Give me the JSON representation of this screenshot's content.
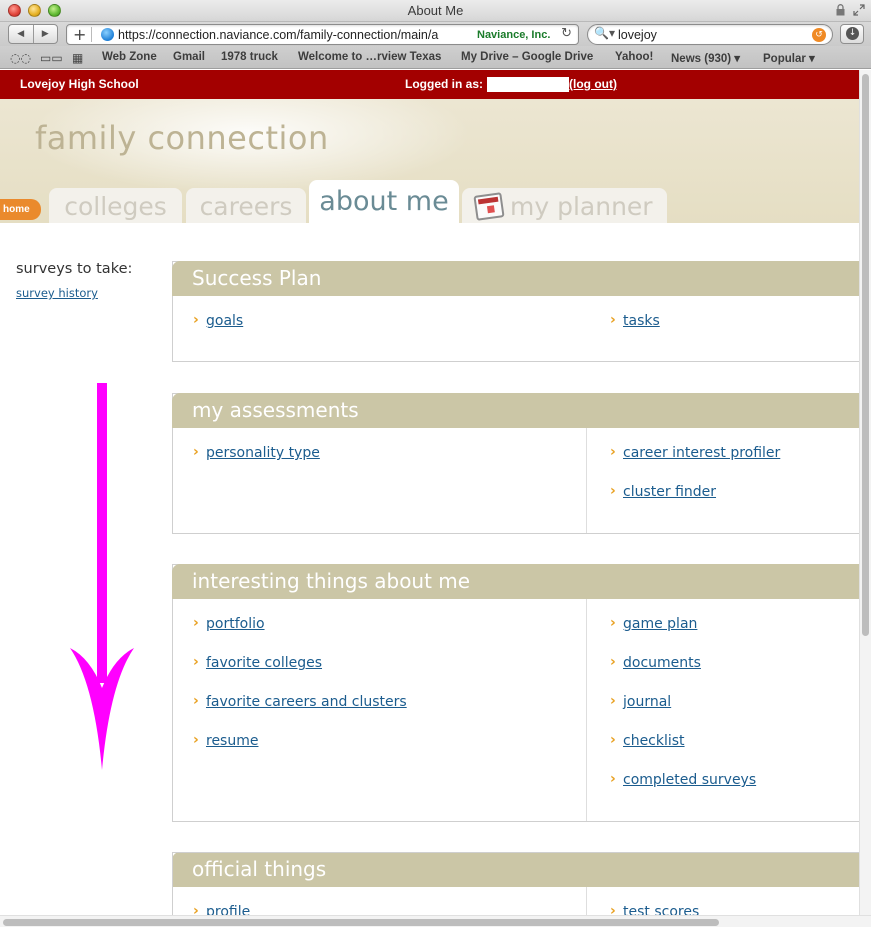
{
  "browser": {
    "window_title": "About Me",
    "url": "https://connection.naviance.com/family-connection/main/a",
    "site_identity": "Naviance, Inc.",
    "search_query": "lovejoy",
    "bookmarks": [
      "Web Zone",
      "Gmail",
      "1978 truck",
      "Welcome to …rview Texas",
      "My Drive – Google Drive",
      "Yahoo!",
      "News (930) ▾",
      "Popular ▾"
    ]
  },
  "header": {
    "school": "Lovejoy High School",
    "logged_in_label": "Logged in as:",
    "logout": "(log out)"
  },
  "brand": "family connection",
  "tabs": {
    "home": "home",
    "colleges": "colleges",
    "careers": "careers",
    "about_me": "about me",
    "my_planner": "my planner"
  },
  "sidebar": {
    "title": "surveys to take:",
    "link": "survey history"
  },
  "panels": [
    {
      "title": "Success Plan",
      "left": [
        "goals"
      ],
      "right": [
        "tasks"
      ]
    },
    {
      "title": "my assessments",
      "left": [
        "personality type"
      ],
      "right": [
        "career interest profiler",
        "cluster finder"
      ]
    },
    {
      "title": "interesting things about me",
      "left": [
        "portfolio",
        "favorite colleges",
        "favorite careers and clusters",
        "resume"
      ],
      "right": [
        "game plan",
        "documents",
        "journal",
        "checklist",
        "completed surveys"
      ]
    },
    {
      "title": "official things",
      "left": [
        "profile"
      ],
      "right": [
        "test scores"
      ]
    }
  ],
  "colors": {
    "school_bar": "#a30000",
    "panel_header": "#cbc6a6",
    "link": "#1b5c8e",
    "chevron": "#e8a020",
    "annotation_arrow": "#ff00ff"
  }
}
